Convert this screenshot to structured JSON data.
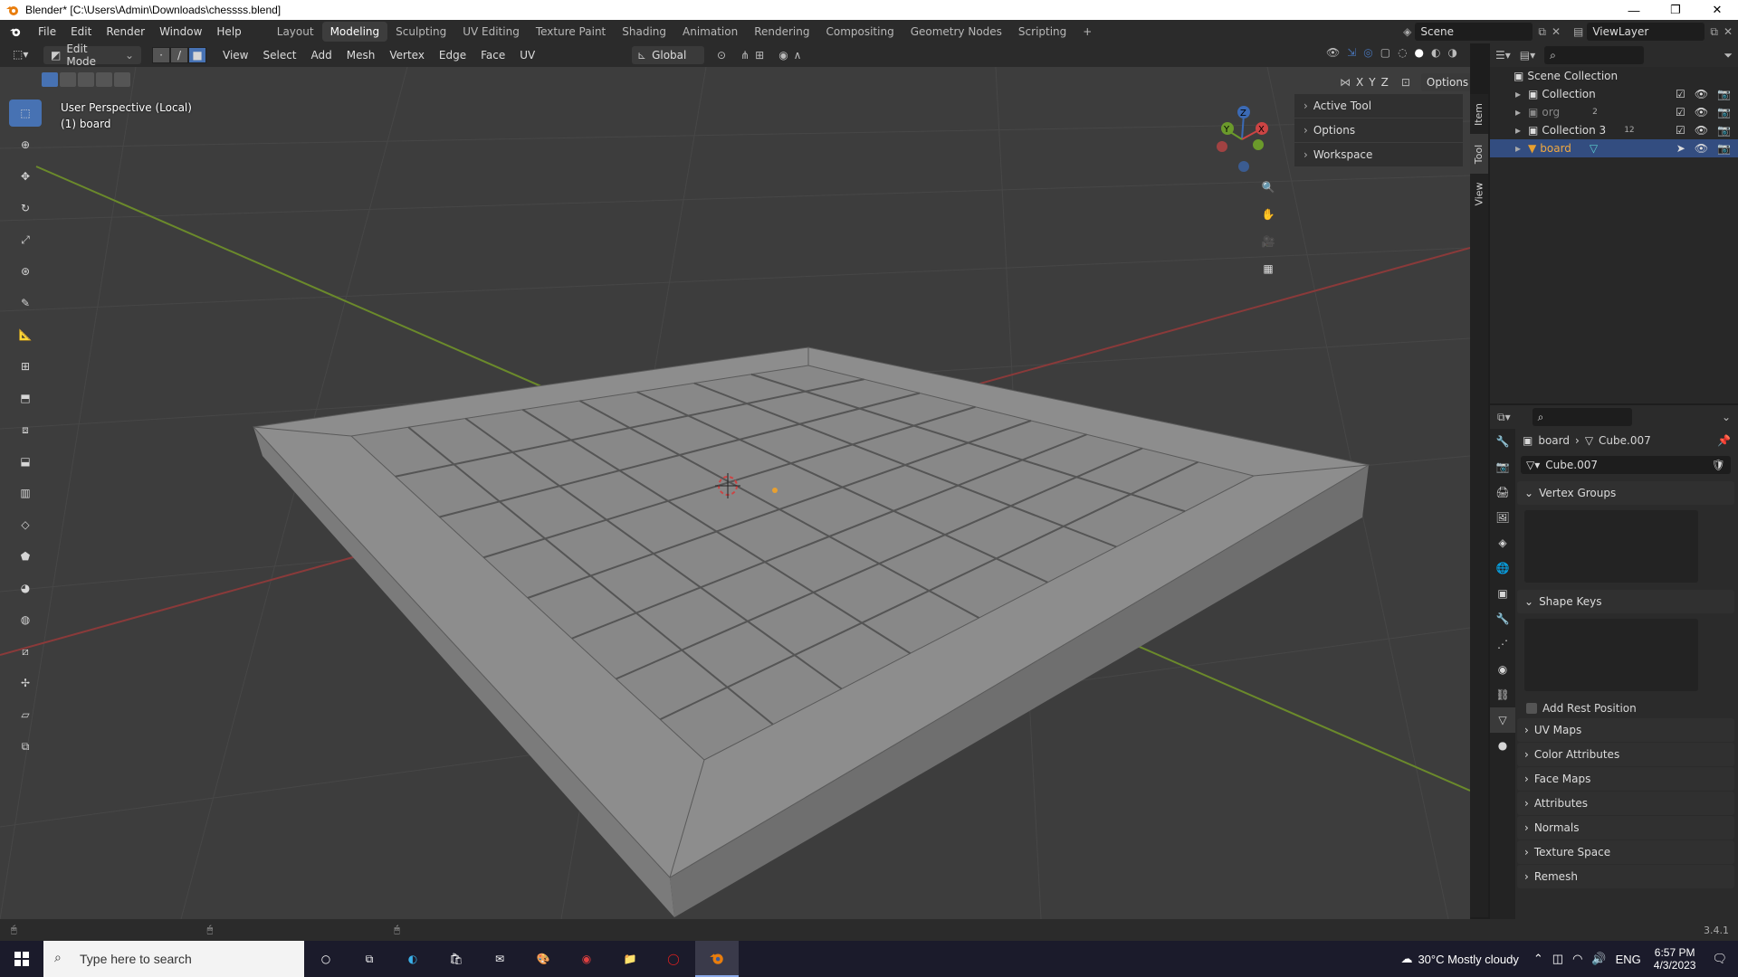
{
  "window": {
    "title": "Blender* [C:\\Users\\Admin\\Downloads\\chessss.blend]",
    "minimize": "—",
    "maximize": "❐",
    "close": "✕"
  },
  "topbar": {
    "menus": [
      "File",
      "Edit",
      "Render",
      "Window",
      "Help"
    ],
    "workspaces": [
      "Layout",
      "Modeling",
      "Sculpting",
      "UV Editing",
      "Texture Paint",
      "Shading",
      "Animation",
      "Rendering",
      "Compositing",
      "Geometry Nodes",
      "Scripting"
    ],
    "active_workspace": "Modeling",
    "add_tab": "+",
    "scene": "Scene",
    "view_layer": "ViewLayer"
  },
  "viewport_header": {
    "mode": "Edit Mode",
    "menus": [
      "View",
      "Select",
      "Add",
      "Mesh",
      "Vertex",
      "Edge",
      "Face",
      "UV"
    ],
    "transform_orientation": "Global",
    "axes": [
      "X",
      "Y",
      "Z"
    ],
    "options": "Options"
  },
  "viewport": {
    "perspective": "User Perspective (Local)",
    "object": "(1) board",
    "colors": {
      "background": "#3d3d3d",
      "board": "#8d8d8d",
      "x_axis": "#8a3a3a",
      "y_axis": "#6b8a2b"
    }
  },
  "npanel": {
    "sections": [
      "Active Tool",
      "Options",
      "Workspace"
    ],
    "tabs": [
      "Item",
      "Tool",
      "View"
    ],
    "active_tab": "Tool"
  },
  "outliner": {
    "root": "Scene Collection",
    "items": [
      {
        "name": "Collection",
        "selected": false
      },
      {
        "name": "org",
        "selected": false,
        "badge": "2"
      },
      {
        "name": "Collection 3",
        "selected": false,
        "badge": "12"
      },
      {
        "name": "board",
        "selected": true
      }
    ]
  },
  "properties": {
    "breadcrumb_object": "board",
    "breadcrumb_mesh": "Cube.007",
    "mesh_name": "Cube.007",
    "panels": {
      "vertex_groups": "Vertex Groups",
      "shape_keys": "Shape Keys",
      "add_rest_position": "Add Rest Position",
      "collapsed": [
        "UV Maps",
        "Color Attributes",
        "Face Maps",
        "Attributes",
        "Normals",
        "Texture Space",
        "Remesh"
      ]
    }
  },
  "statusbar": {
    "version": "3.4.1"
  },
  "taskbar": {
    "search_placeholder": "Type here to search",
    "weather": "30°C  Mostly cloudy",
    "lang": "ENG",
    "time": "6:57 PM",
    "date": "4/3/2023"
  }
}
